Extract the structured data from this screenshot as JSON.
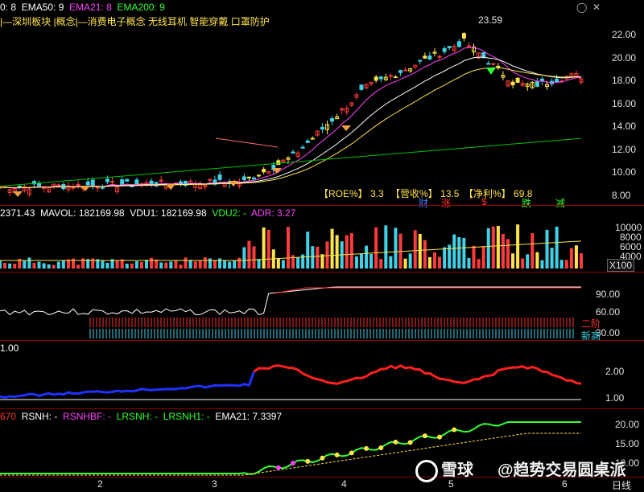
{
  "price_panel": {
    "legend": [
      {
        "label": "0: 8",
        "color": "#ffffff"
      },
      {
        "label": "EMA50: 9",
        "color": "#ffffff"
      },
      {
        "label": "EMA21: 8",
        "color": "#ff40ff"
      },
      {
        "label": "EMA200: 9",
        "color": "#00e000"
      }
    ],
    "concepts": "|—深圳板块 |概念|—消费电子概念 无线耳机 智能穿戴 口罩防护",
    "peak_label": "23.59",
    "y_ticks": [
      "22.00",
      "20.00",
      "18.00",
      "16.00",
      "14.00",
      "12.00",
      "10.00",
      "8.00"
    ],
    "fundamentals": [
      {
        "key": "【ROE%】",
        "value": "3.3"
      },
      {
        "key": "【营收%】",
        "value": "13.5"
      },
      {
        "key": "【净利%】",
        "value": "69.8"
      }
    ],
    "badges": [
      {
        "text": "财",
        "color": "#3a7dff"
      },
      {
        "text": "涨",
        "color": "#ff3030"
      },
      {
        "text": "$",
        "color": "#ff3030"
      },
      {
        "text": "跌",
        "color": "#33ff33"
      },
      {
        "text": "减",
        "color": "#33ff33"
      }
    ],
    "colors": {
      "up": "#ff3b3b",
      "down": "#3fd1e6",
      "ema21": "#ff40ff",
      "ema50": "#ffffff",
      "ema200": "#00c000",
      "yellow": "#ffe34d"
    }
  },
  "volume_panel": {
    "legend": [
      {
        "label": "2371.43",
        "color": "#ffffff"
      },
      {
        "label": "MAVOL: 182169.98",
        "color": "#ffffff"
      },
      {
        "label": "VDU1: 182169.98",
        "color": "#ffffff"
      },
      {
        "label": "VDU2: -",
        "color": "#33ff33"
      },
      {
        "label": "ADR: 3.27",
        "color": "#ff40ff"
      }
    ],
    "y_ticks": [
      "10000",
      "8000",
      "6000",
      "4000",
      "2000"
    ],
    "unit": "X100"
  },
  "rs_panel": {
    "y_ticks": [
      "90.00",
      "60.00",
      "30.00"
    ],
    "labels": [
      {
        "text": "二阶",
        "color": "#ff3030"
      },
      {
        "text": "新高",
        "color": "#3fd1e6"
      }
    ]
  },
  "ratio_panel": {
    "legend": "1.00",
    "y_ticks": [
      "2.00",
      "1.00"
    ]
  },
  "rsnh_panel": {
    "legend": [
      {
        "label": "670",
        "color": "#ff3030"
      },
      {
        "label": "RSNH: -",
        "color": "#ffffff"
      },
      {
        "label": "RSNHBF: -",
        "color": "#ff40ff"
      },
      {
        "label": "LRSNH: -",
        "color": "#33ff33"
      },
      {
        "label": "LRSNH1: -",
        "color": "#33ff33"
      },
      {
        "label": "EMA21: 7.3397",
        "color": "#ffffff"
      }
    ],
    "y_ticks": [
      "20.00",
      "15.00",
      "10.00"
    ]
  },
  "x_axis": {
    "months": [
      "2",
      "3",
      "4",
      "5",
      "6"
    ],
    "unit_label": "日线"
  },
  "watermark": {
    "brand": "雪球",
    "author": "趋势交易圆桌派"
  }
}
